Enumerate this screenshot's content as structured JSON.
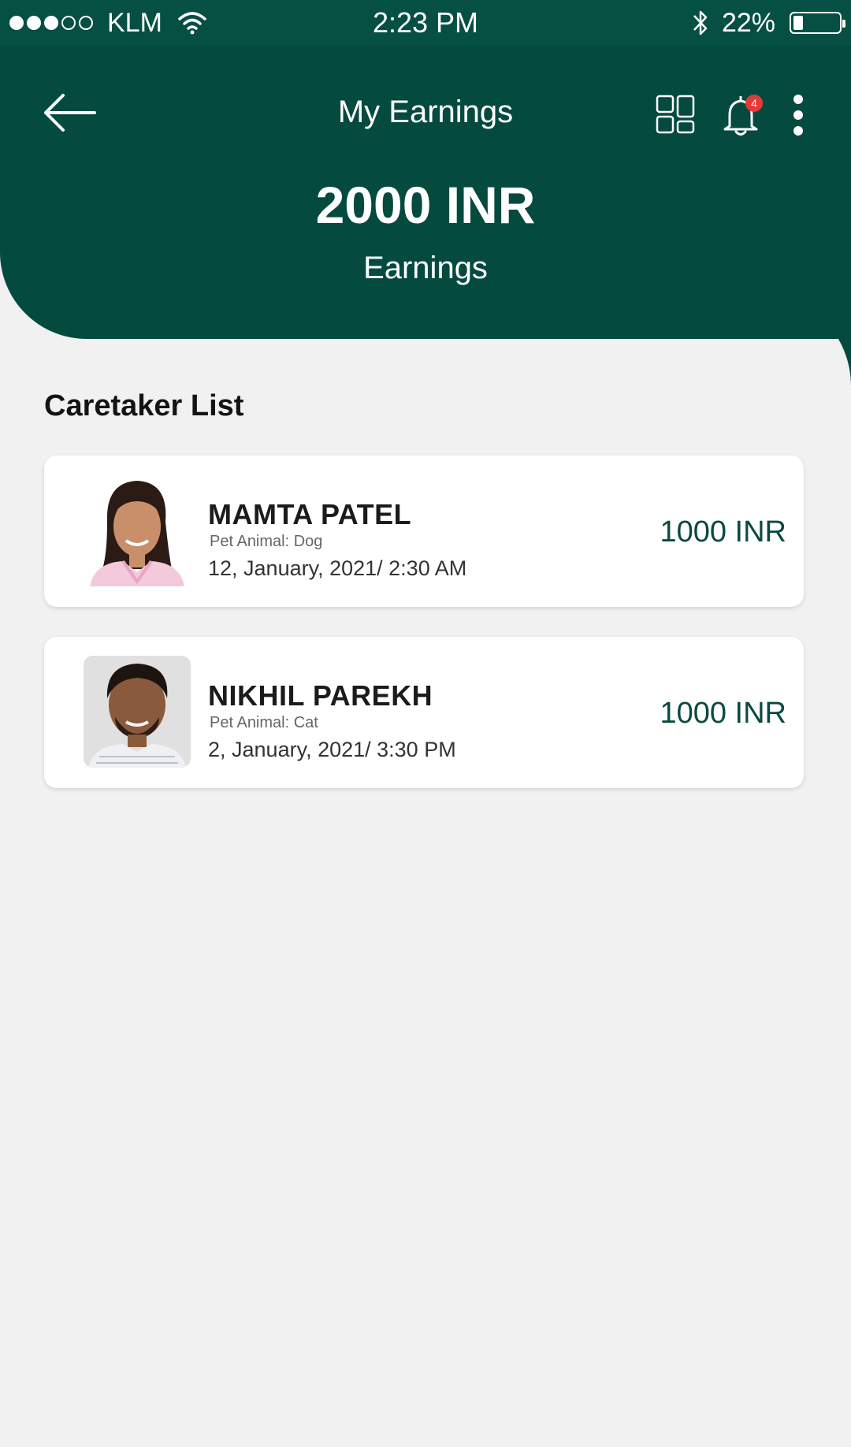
{
  "status_bar": {
    "carrier": "KLM",
    "time": "2:23 PM",
    "battery_percent": "22%",
    "battery_level": 0.22,
    "signal_bars_filled": 3,
    "signal_bars_total": 5
  },
  "header": {
    "title": "My Earnings",
    "notification_count": "4",
    "icons": [
      "back-arrow-icon",
      "dashboard-grid-icon",
      "bell-icon",
      "more-vertical-icon"
    ]
  },
  "summary": {
    "amount": "2000 INR",
    "label": "Earnings"
  },
  "caretakers": {
    "title": "Caretaker List",
    "items": [
      {
        "name": "MAMTA PATEL",
        "pet": "Pet Animal: Dog",
        "datetime": "12, January, 2021/ 2:30 AM",
        "amount": "1000 INR"
      },
      {
        "name": "NIKHIL PAREKH",
        "pet": "Pet Animal: Cat",
        "datetime": "2, January, 2021/ 3:30 PM",
        "amount": "1000 INR"
      }
    ]
  },
  "colors": {
    "header_green": "#054a3f",
    "background": "#f1f1f1",
    "amount_text": "#0a4a40",
    "badge_red": "#e53935"
  }
}
